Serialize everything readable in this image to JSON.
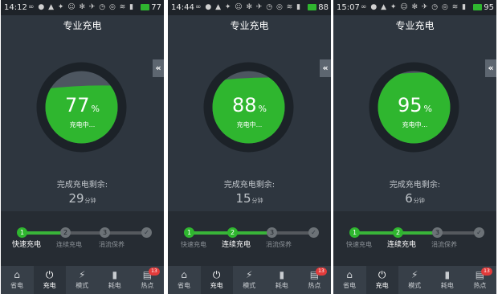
{
  "colors": {
    "bg": "#2e363f",
    "green": "#2fb62f",
    "ring": "#1c2228",
    "empty": "#4d5660"
  },
  "title": "专业充电",
  "remain_label": "完成充电剩余:",
  "minute_unit": "分钟",
  "charging_text": "充电中...",
  "percent_unit": "%",
  "collapse_icon": "«",
  "status_icons": "∞ ● ▲ ✦ ☺ ✻ ✈ ◷ ◎ ≋ ▮",
  "steps": {
    "labels": [
      "快速充电",
      "连续充电",
      "涓流保养"
    ],
    "numbers": [
      "1",
      "2",
      "3"
    ],
    "check": "✓"
  },
  "nav": {
    "items": [
      {
        "label": "省电",
        "icon": "⌂"
      },
      {
        "label": "充电",
        "icon": "⏻"
      },
      {
        "label": "模式",
        "icon": "⚡"
      },
      {
        "label": "耗电",
        "icon": "▮"
      },
      {
        "label": "热点",
        "icon": "▤"
      }
    ],
    "badge": "13"
  },
  "screens": [
    {
      "time": "14:12",
      "battery": "77",
      "percent": "77",
      "minutes": "29",
      "stage": 1,
      "fill": 0.77
    },
    {
      "time": "14:44",
      "battery": "88",
      "percent": "88",
      "minutes": "15",
      "stage": 2,
      "fill": 0.88
    },
    {
      "time": "15:07",
      "battery": "95",
      "percent": "95",
      "minutes": "6",
      "stage": 2,
      "fill": 0.95
    }
  ]
}
